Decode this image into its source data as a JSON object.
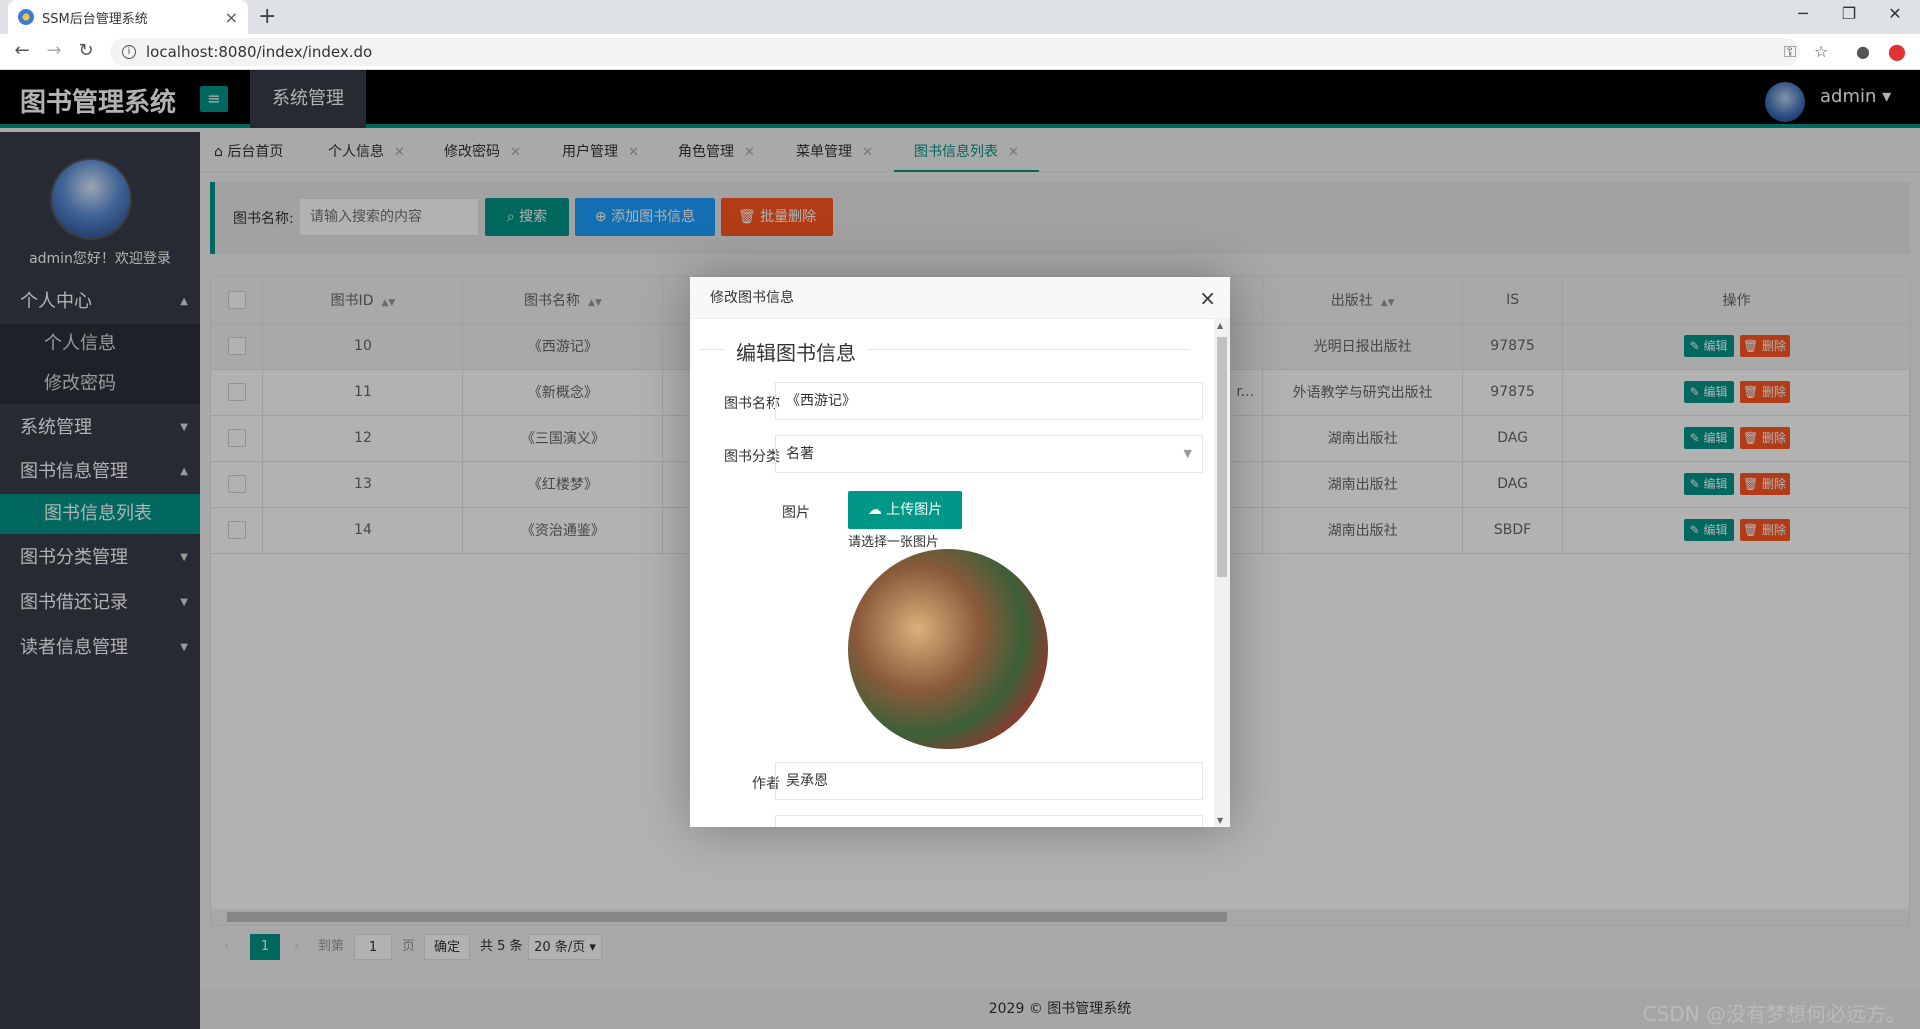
{
  "browser": {
    "tab_title": "SSM后台管理系统",
    "tab_close": "×",
    "new_tab": "+",
    "url": "localhost:8080/index/index.do",
    "win_min": "─",
    "win_max": "❐",
    "win_close": "✕"
  },
  "header": {
    "logo": "图书管理系统",
    "menu_icon": "≡",
    "section": "系统管理",
    "user": "admin ▾"
  },
  "sidebar": {
    "welcome": "admin您好！欢迎登录",
    "groups": [
      {
        "label": "个人中心",
        "arrow": "▲"
      },
      {
        "label": "系统管理",
        "arrow": "▼"
      },
      {
        "label": "图书信息管理",
        "arrow": "▲"
      },
      {
        "label": "图书分类管理",
        "arrow": "▼"
      },
      {
        "label": "图书借还记录",
        "arrow": "▼"
      },
      {
        "label": "读者信息管理",
        "arrow": "▼"
      }
    ],
    "subitems": [
      "个人信息",
      "修改密码",
      "图书信息列表"
    ]
  },
  "page_tabs": [
    {
      "label": "后台首页"
    },
    {
      "label": "个人信息"
    },
    {
      "label": "修改密码"
    },
    {
      "label": "用户管理"
    },
    {
      "label": "角色管理"
    },
    {
      "label": "菜单管理"
    },
    {
      "label": "图书信息列表"
    }
  ],
  "search": {
    "label": "图书名称:",
    "placeholder": "请输入搜索的内容",
    "search_btn": "搜索",
    "add_btn": "添加图书信息",
    "batch_delete_btn": "批量删除"
  },
  "table": {
    "headers": [
      "图书ID",
      "图书名称",
      "出版社",
      "IS",
      "操作"
    ],
    "rows": [
      {
        "id": "10",
        "name": "《西游记》",
        "mid": "",
        "publisher": "光明日报出版社",
        "isbn": "97875"
      },
      {
        "id": "11",
        "name": "《新概念》",
        "mid": "r...",
        "publisher": "外语教学与研究出版社",
        "isbn": "97875"
      },
      {
        "id": "12",
        "name": "《三国演义》",
        "mid": "",
        "publisher": "湖南出版社",
        "isbn": "DAG"
      },
      {
        "id": "13",
        "name": "《红楼梦》",
        "mid": "",
        "publisher": "湖南出版社",
        "isbn": "DAG"
      },
      {
        "id": "14",
        "name": "《资治通鉴》",
        "mid": "",
        "publisher": "湖南出版社",
        "isbn": "SBDF"
      }
    ],
    "edit_label": "✎ 编辑",
    "delete_label": "🗑 删除"
  },
  "pager": {
    "current": "1",
    "goto_label": "到第",
    "goto_value": "1",
    "page_unit": "页",
    "confirm": "确定",
    "total": "共 5 条",
    "per_page": "20 条/页 ▾"
  },
  "footer": "2029 © 图书管理系统",
  "watermark": "CSDN @没有梦想何必远方。",
  "modal": {
    "title": "修改图书信息",
    "close": "×",
    "legend": "编辑图书信息",
    "name_label": "图书名称",
    "name_value": "《西游记》",
    "category_label": "图书分类",
    "category_value": "名著",
    "image_label": "图片",
    "upload_btn": "上传图片",
    "upload_hint": "请选择一张图片",
    "author_label": "作者",
    "author_value": "吴承恩"
  },
  "colors": {
    "accent": "#009688",
    "blue": "#1E9FFF",
    "danger": "#FF5722",
    "sidebar": "#393d49"
  }
}
